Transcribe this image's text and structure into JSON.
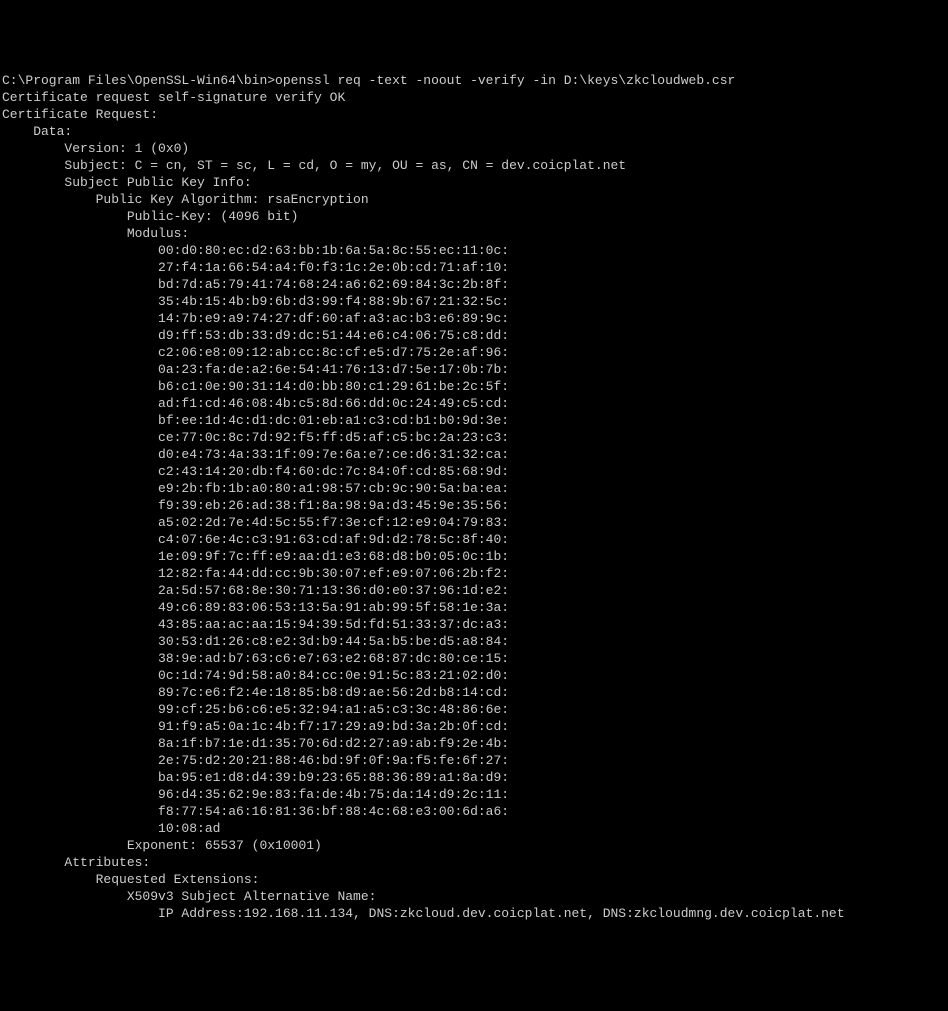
{
  "terminal": {
    "prompt_line": "C:\\Program Files\\OpenSSL-Win64\\bin>openssl req -text -noout -verify -in D:\\keys\\zkcloudweb.csr",
    "verify_result": "Certificate request self-signature verify OK",
    "header": "Certificate Request:",
    "data_label": "    Data:",
    "version": "        Version: 1 (0x0)",
    "subject": "        Subject: C = cn, ST = sc, L = cd, O = my, OU = as, CN = dev.coicplat.net",
    "pubkey_info": "        Subject Public Key Info:",
    "pubkey_algo": "            Public Key Algorithm: rsaEncryption",
    "pubkey_bits": "                Public-Key: (4096 bit)",
    "modulus_label": "                Modulus:",
    "modulus_lines": [
      "                    00:d0:80:ec:d2:63:bb:1b:6a:5a:8c:55:ec:11:0c:",
      "                    27:f4:1a:66:54:a4:f0:f3:1c:2e:0b:cd:71:af:10:",
      "                    bd:7d:a5:79:41:74:68:24:a6:62:69:84:3c:2b:8f:",
      "                    35:4b:15:4b:b9:6b:d3:99:f4:88:9b:67:21:32:5c:",
      "                    14:7b:e9:a9:74:27:df:60:af:a3:ac:b3:e6:89:9c:",
      "                    d9:ff:53:db:33:d9:dc:51:44:e6:c4:06:75:c8:dd:",
      "                    c2:06:e8:09:12:ab:cc:8c:cf:e5:d7:75:2e:af:96:",
      "                    0a:23:fa:de:a2:6e:54:41:76:13:d7:5e:17:0b:7b:",
      "                    b6:c1:0e:90:31:14:d0:bb:80:c1:29:61:be:2c:5f:",
      "                    ad:f1:cd:46:08:4b:c5:8d:66:dd:0c:24:49:c5:cd:",
      "                    bf:ee:1d:4c:d1:dc:01:eb:a1:c3:cd:b1:b0:9d:3e:",
      "                    ce:77:0c:8c:7d:92:f5:ff:d5:af:c5:bc:2a:23:c3:",
      "                    d0:e4:73:4a:33:1f:09:7e:6a:e7:ce:d6:31:32:ca:",
      "                    c2:43:14:20:db:f4:60:dc:7c:84:0f:cd:85:68:9d:",
      "                    e9:2b:fb:1b:a0:80:a1:98:57:cb:9c:90:5a:ba:ea:",
      "                    f9:39:eb:26:ad:38:f1:8a:98:9a:d3:45:9e:35:56:",
      "                    a5:02:2d:7e:4d:5c:55:f7:3e:cf:12:e9:04:79:83:",
      "                    c4:07:6e:4c:c3:91:63:cd:af:9d:d2:78:5c:8f:40:",
      "                    1e:09:9f:7c:ff:e9:aa:d1:e3:68:d8:b0:05:0c:1b:",
      "                    12:82:fa:44:dd:cc:9b:30:07:ef:e9:07:06:2b:f2:",
      "                    2a:5d:57:68:8e:30:71:13:36:d0:e0:37:96:1d:e2:",
      "                    49:c6:89:83:06:53:13:5a:91:ab:99:5f:58:1e:3a:",
      "                    43:85:aa:ac:aa:15:94:39:5d:fd:51:33:37:dc:a3:",
      "                    30:53:d1:26:c8:e2:3d:b9:44:5a:b5:be:d5:a8:84:",
      "                    38:9e:ad:b7:63:c6:e7:63:e2:68:87:dc:80:ce:15:",
      "                    0c:1d:74:9d:58:a0:84:cc:0e:91:5c:83:21:02:d0:",
      "                    89:7c:e6:f2:4e:18:85:b8:d9:ae:56:2d:b8:14:cd:",
      "                    99:cf:25:b6:c6:e5:32:94:a1:a5:c3:3c:48:86:6e:",
      "                    91:f9:a5:0a:1c:4b:f7:17:29:a9:bd:3a:2b:0f:cd:",
      "                    8a:1f:b7:1e:d1:35:70:6d:d2:27:a9:ab:f9:2e:4b:",
      "                    2e:75:d2:20:21:88:46:bd:9f:0f:9a:f5:fe:6f:27:",
      "                    ba:95:e1:d8:d4:39:b9:23:65:88:36:89:a1:8a:d9:",
      "                    96:d4:35:62:9e:83:fa:de:4b:75:da:14:d9:2c:11:",
      "                    f8:77:54:a6:16:81:36:bf:88:4c:68:e3:00:6d:a6:",
      "                    10:08:ad"
    ],
    "exponent": "                Exponent: 65537 (0x10001)",
    "attributes_label": "        Attributes:",
    "req_ext_label": "            Requested Extensions:",
    "san_label": "                X509v3 Subject Alternative Name:",
    "san_value": "                    IP Address:192.168.11.134, DNS:zkcloud.dev.coicplat.net, DNS:zkcloudmng.dev.coicplat.net"
  }
}
